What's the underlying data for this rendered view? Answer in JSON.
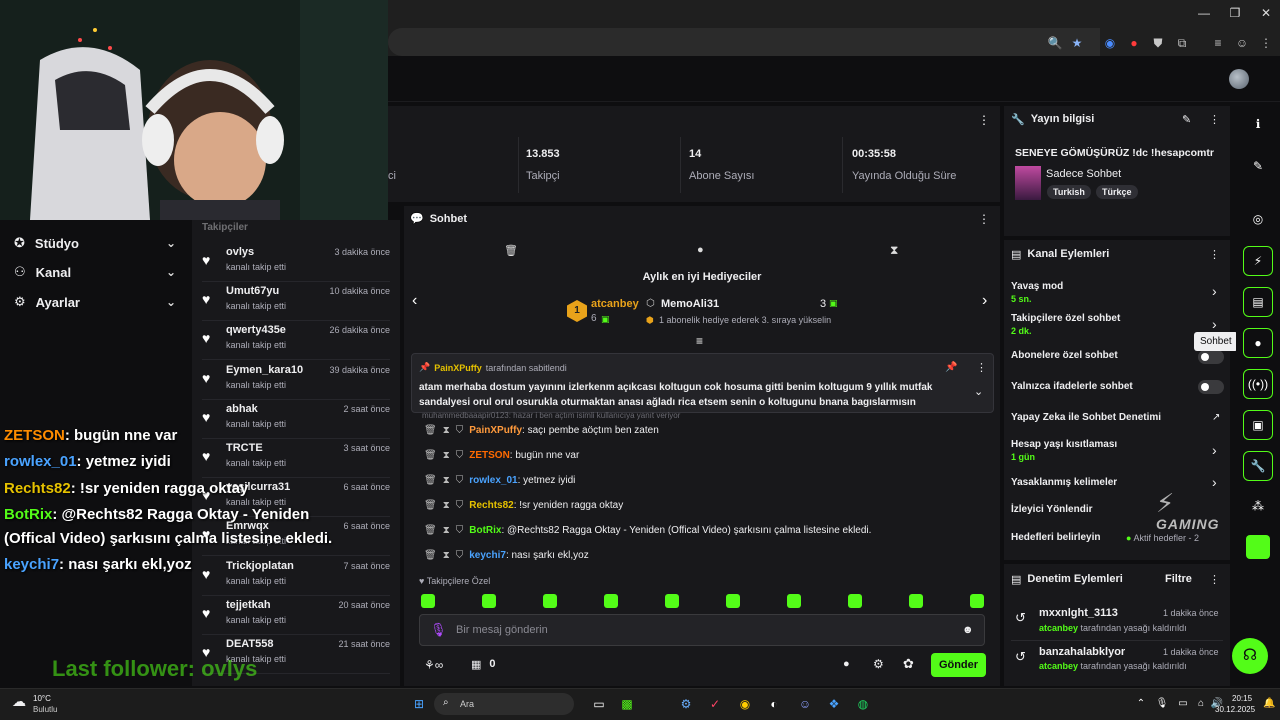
{
  "browser": {
    "window_controls": [
      "—",
      "❐",
      "✕"
    ]
  },
  "sidebar": {
    "items": [
      {
        "label": "Stüdyo",
        "icon": "palette-icon"
      },
      {
        "label": "Kanal",
        "icon": "users-icon"
      },
      {
        "label": "Ayarlar",
        "icon": "gear-icon"
      }
    ]
  },
  "followers_panel": {
    "header": "Takipçiler",
    "items": [
      {
        "name": "ovlys",
        "time": "3 dakika önce",
        "sub": "kanalı takip etti"
      },
      {
        "name": "Umut67yu",
        "time": "10 dakika önce",
        "sub": "kanalı takip etti"
      },
      {
        "name": "qwerty435e",
        "time": "26 dakika önce",
        "sub": "kanalı takip etti"
      },
      {
        "name": "Eymen_kara10",
        "time": "39 dakika önce",
        "sub": "kanalı takip etti"
      },
      {
        "name": "abhak",
        "time": "2 saat önce",
        "sub": "kanalı takip etti"
      },
      {
        "name": "TRCTE",
        "time": "3 saat önce",
        "sub": "kanalı takip etti"
      },
      {
        "name": "yeşilcurra31",
        "time": "6 saat önce",
        "sub": "kanalı takip etti"
      },
      {
        "name": "Emrwqx",
        "time": "6 saat önce",
        "sub": "kanalı takip etti"
      },
      {
        "name": "Trickjoplatan",
        "time": "7 saat önce",
        "sub": "kanalı takip etti"
      },
      {
        "name": "tejjetkah",
        "time": "20 saat önce",
        "sub": "kanalı takip etti"
      },
      {
        "name": "DEAT558",
        "time": "21 saat önce",
        "sub": "kanalı takip etti"
      }
    ]
  },
  "overlay": {
    "chat": [
      {
        "user": "ZETSON",
        "text": ": bugün nne var",
        "color": "#ff8c00"
      },
      {
        "user": "rowlex_01",
        "text": ": yetmez iyidi",
        "color": "#4aa3ff"
      },
      {
        "user": "Rechts82",
        "text": ": !sr yeniden ragga oktay",
        "color": "#e6c200"
      },
      {
        "user": "BotRix",
        "text": ": @Rechts82 Ragga Oktay - Yeniden",
        "color": "#53fc18"
      },
      {
        "user": "",
        "text": "(Offical Video) şarkısını çalma listesine ekledi.",
        "color": "#ffffff"
      },
      {
        "user": "keychi7",
        "text": ": nası şarkı ekl,yoz",
        "color": "#4aa3ff"
      }
    ],
    "last_follower": "Last follower: ovlys"
  },
  "stats": {
    "partial_label": "ci",
    "items": [
      {
        "value": "13.853",
        "label": "Takipçi"
      },
      {
        "value": "14",
        "label": "Abone Sayısı"
      },
      {
        "value": "00:35:58",
        "label": "Yayında Olduğu Süre"
      }
    ]
  },
  "chat": {
    "title": "Sohbet",
    "top_gifters_title": "Aylık en iyi Hediyeciler",
    "gifter1": {
      "rank": "1",
      "name": "atcanbey",
      "count": "6"
    },
    "gifter2": {
      "name": "MemoAli31",
      "count": "3",
      "note": "1 abonelik hediye ederek 3. sıraya yükselin"
    },
    "pinned_by_user": "PainXPuffy",
    "pinned_by_suffix": "tarafından sabitlendi",
    "pinned_text": "atam merhaba dostum yayınını izlerkenm açıkcası koltugun cok hosuma gitti benim koltugum 9 yıllık mutfak sandalyesi orul orul osurukla oturmaktan anası ağladı rica etsem senin o koltugunu bnana bagıslarmısın",
    "faded_line": "muhammedbaaapir0123: hazar i ben açtım isimli kullanıcıya yanıt veriyor",
    "messages": [
      {
        "user": "PainXPuffy",
        "text": ": saçı pembe aöçtım ben zaten",
        "color": "#ff9a3c"
      },
      {
        "user": "ZETSON",
        "text": ": bugün nne var",
        "color": "#ff6a00"
      },
      {
        "user": "rowlex_01",
        "text": ": yetmez iyidi",
        "color": "#4aa3ff"
      },
      {
        "user": "Rechts82",
        "text": ": !sr yeniden ragga oktay",
        "color": "#e6c200"
      },
      {
        "user": "BotRix",
        "text": ": @Rechts82 Ragga Oktay - Yeniden (Offical Video) şarkısını çalma listesine ekledi.",
        "color": "#53fc18"
      },
      {
        "user": "keychi7",
        "text": ": nası şarkı ekl,yoz",
        "color": "#4aa3ff"
      }
    ],
    "followers_only_label": "Takipçilere Özel",
    "input_placeholder": "Bir mesaj gönderin",
    "points": "0",
    "send_label": "Gönder"
  },
  "stream_info": {
    "title": "Yayın bilgisi",
    "stream_title": "SENEYE GÖMÜŞÜRÜZ !dc !hesapcomtr",
    "category": "Sadece Sohbet",
    "tags": [
      "Turkish",
      "Türkçe"
    ]
  },
  "channel_actions": {
    "title": "Kanal Eylemleri",
    "items": [
      {
        "label": "Yavaş mod",
        "sub": "5 sn."
      },
      {
        "label": "Takipçilere özel sohbet",
        "sub": "2 dk."
      },
      {
        "label": "Abonelere özel sohbet"
      },
      {
        "label": "Yalnızca ifadelerle sohbet"
      },
      {
        "label": "Yapay Zeka ile Sohbet Denetimi"
      },
      {
        "label": "Hesap yaşı kısıtlaması",
        "sub": "1 gün"
      },
      {
        "label": "Yasaklanmış kelimeler"
      },
      {
        "label": "İzleyici Yönlendir"
      },
      {
        "label": "Hedefleri belirleyin",
        "extra": "Aktif hedefler - 2"
      }
    ],
    "tooltip": "Sohbet"
  },
  "mod_actions": {
    "title": "Denetim Eylemleri",
    "filter_label": "Filtre",
    "items": [
      {
        "user": "mxxnlght_3113",
        "time": "1 dakika önce",
        "by": "atcanbey",
        "action": "tarafından yasağı kaldırıldı"
      },
      {
        "user": "banzahalabklyor",
        "time": "1 dakika önce",
        "by": "atcanbey",
        "action": "tarafından yasağı kaldırıldı"
      }
    ]
  },
  "overlay_logo": "GAMING",
  "taskbar": {
    "weather_temp": "10°C",
    "weather_desc": "Bulutlu",
    "search_placeholder": "Ara",
    "time": "20:15",
    "date": "30.12.2025"
  },
  "colors": {
    "accent": "#53fc18",
    "panel": "#18181b",
    "bg": "#0e0e10"
  }
}
